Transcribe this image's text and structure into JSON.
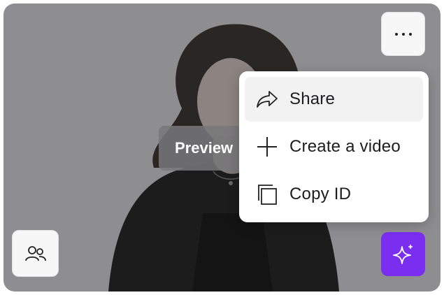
{
  "card": {
    "overlay_label": "Preview"
  },
  "buttons": {
    "more_icon": "ellipsis-icon",
    "people_icon": "users-icon",
    "ai_icon": "sparkles-icon",
    "ai_color": "#7a2ef0"
  },
  "menu": {
    "items": [
      {
        "label": "Share",
        "icon": "share-arrow-icon"
      },
      {
        "label": "Create a video",
        "icon": "plus-icon"
      },
      {
        "label": "Copy ID",
        "icon": "copy-icon"
      }
    ]
  }
}
